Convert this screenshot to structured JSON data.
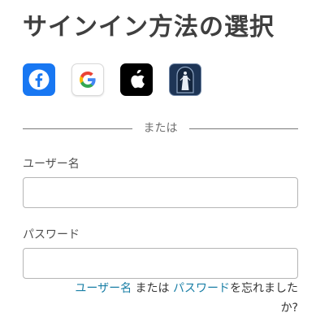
{
  "title": "サインイン方法の選択",
  "providers": [
    {
      "name": "Facebook",
      "icon": "facebook-icon",
      "color": "#1877f2"
    },
    {
      "name": "Google",
      "icon": "google-icon",
      "color": "#ffffff"
    },
    {
      "name": "Apple",
      "icon": "apple-icon",
      "color": "#000000"
    },
    {
      "name": "Church Account",
      "icon": "church-logo-icon",
      "color": "#1e3556"
    }
  ],
  "divider_text": "または",
  "username": {
    "label": "ユーザー名",
    "value": "",
    "placeholder": ""
  },
  "password": {
    "label": "パスワード",
    "value": "",
    "placeholder": ""
  },
  "forgot": {
    "username_link": "ユーザー名",
    "or_text": " または ",
    "password_link": "パスワード",
    "suffix_line1": "を忘れまし",
    "suffix_line2": "た",
    "suffix_line3": "か?"
  },
  "colors": {
    "link": "#1a7fa6",
    "title": "#3f3f3f"
  }
}
